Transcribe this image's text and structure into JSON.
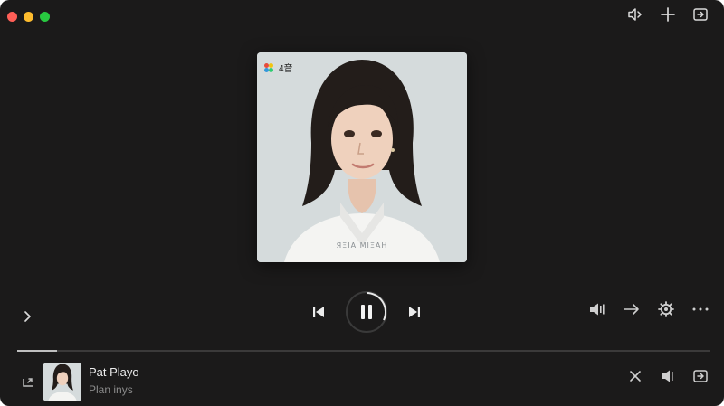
{
  "window": {
    "title": ""
  },
  "toolbar": {
    "icons": [
      "speaker-icon",
      "plus-icon",
      "picture-in-picture-icon"
    ]
  },
  "artwork": {
    "badge_text": "4音",
    "caption": "ЯΞIΑ ΜΙΞΑΗ",
    "badge_icon": "pinwheel-icon"
  },
  "player": {
    "state": "playing",
    "progress": 0.057,
    "controls": [
      "previous-track-icon",
      "pause-icon",
      "next-track-icon"
    ],
    "right_controls": [
      "volume-icon",
      "arrow-right-icon",
      "gear-icon",
      "more-icon"
    ]
  },
  "now_playing": {
    "title": "Pat Playo",
    "subtitle": "Plan inys"
  },
  "colors": {
    "background": "#1b1a1a",
    "progress_fill": "#bfbfbf",
    "progress_track": "#3b3a3a",
    "close": "#ff5f57",
    "minimize": "#febc2e",
    "maximize": "#28c840"
  }
}
